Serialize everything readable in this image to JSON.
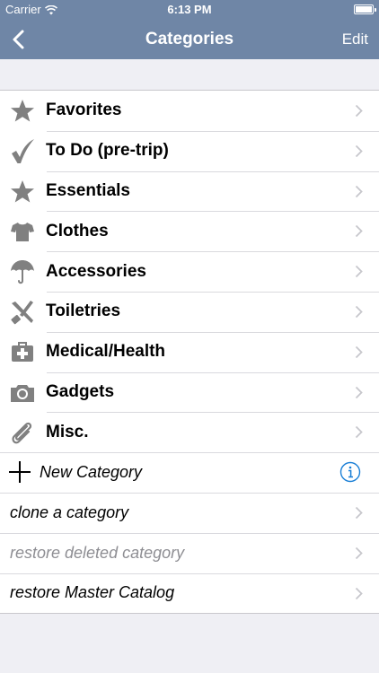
{
  "status_bar": {
    "carrier": "Carrier",
    "time": "6:13 PM"
  },
  "nav": {
    "title": "Categories",
    "edit_label": "Edit"
  },
  "categories": [
    {
      "label": "Favorites",
      "icon": "star-icon"
    },
    {
      "label": "To Do (pre-trip)",
      "icon": "checkmark-icon"
    },
    {
      "label": "Essentials",
      "icon": "star-icon"
    },
    {
      "label": "Clothes",
      "icon": "tshirt-icon"
    },
    {
      "label": "Accessories",
      "icon": "umbrella-icon"
    },
    {
      "label": "Toiletries",
      "icon": "toothbrush-razor-icon"
    },
    {
      "label": "Medical/Health",
      "icon": "medkit-icon"
    },
    {
      "label": "Gadgets",
      "icon": "camera-icon"
    },
    {
      "label": "Misc.",
      "icon": "paperclip-icon"
    }
  ],
  "new_category_label": "New Category",
  "actions": [
    {
      "label": "clone a category",
      "dim": false
    },
    {
      "label": "restore deleted category",
      "dim": true
    },
    {
      "label": "restore Master Catalog",
      "dim": false
    }
  ],
  "colors": {
    "nav_bar": "#6f86a6",
    "background": "#efeff4",
    "icon_gray": "#808080",
    "chevron": "#c7c7cc",
    "info_blue": "#1a7fd6",
    "dim_text": "#8e8e93"
  }
}
